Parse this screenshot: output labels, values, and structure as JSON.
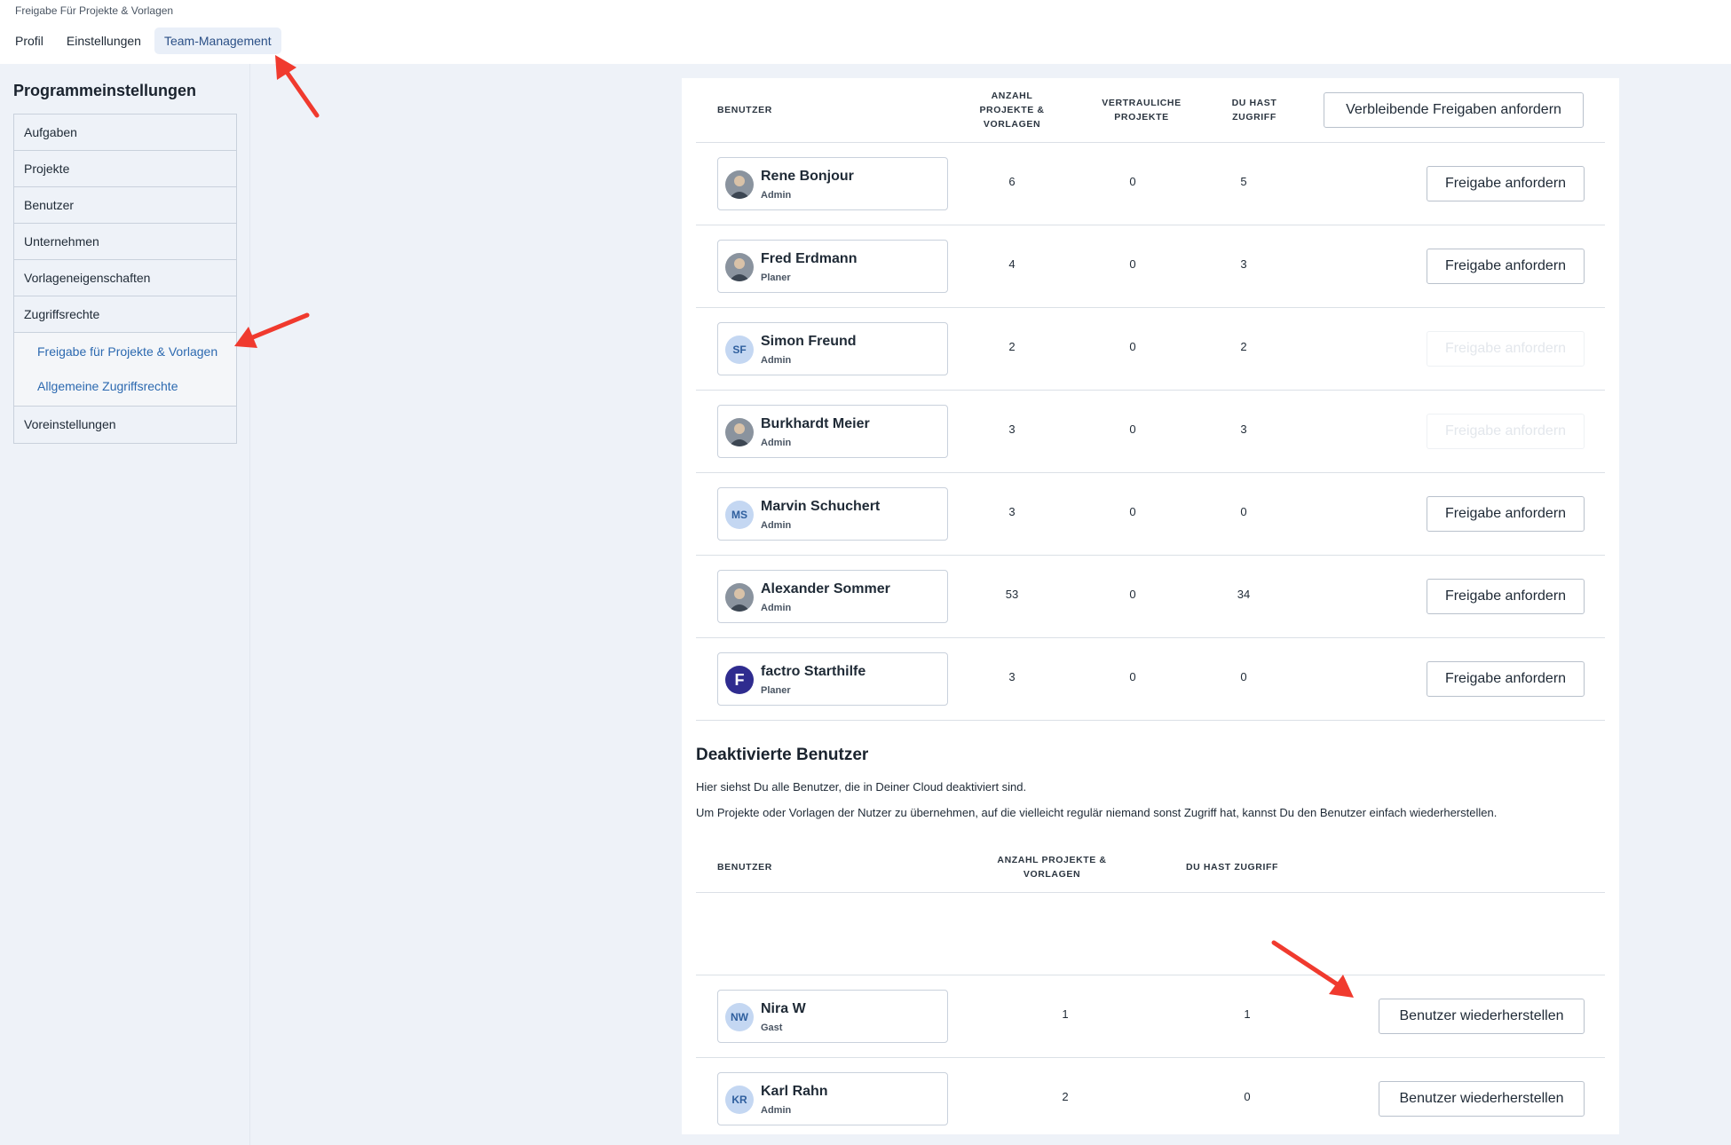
{
  "breadcrumb": "Freigabe Für Projekte & Vorlagen",
  "tabs": [
    {
      "label": "Profil"
    },
    {
      "label": "Einstellungen"
    },
    {
      "label": "Team-Management",
      "active": true
    }
  ],
  "sidebar": {
    "title": "Programmeinstellungen",
    "items": [
      {
        "label": "Aufgaben"
      },
      {
        "label": "Projekte"
      },
      {
        "label": "Benutzer"
      },
      {
        "label": "Unternehmen"
      },
      {
        "label": "Vorlageneigenschaften"
      },
      {
        "label": "Zugriffsrechte"
      },
      {
        "label": "Voreinstellungen"
      }
    ],
    "subitems": [
      {
        "label": "Freigabe für Projekte & Vorlagen"
      },
      {
        "label": "Allgemeine Zugriffsrechte"
      }
    ]
  },
  "active_table": {
    "headers": {
      "user": "BENUTZER",
      "count": "ANZAHL PROJEKTE & VORLAGEN",
      "confidential": "VERTRAULICHE PROJEKTE",
      "access": "DU HAST ZUGRIFF"
    },
    "request_all_label": "Verbleibende Freigaben anfordern",
    "rows": [
      {
        "name": "Rene Bonjour",
        "role": "Admin",
        "initials": "",
        "avatar": "photo",
        "count": "6",
        "confidential": "0",
        "access": "5",
        "button": "Freigabe anfordern",
        "enabled": true
      },
      {
        "name": "Fred Erdmann",
        "role": "Planer",
        "initials": "",
        "avatar": "photo",
        "count": "4",
        "confidential": "0",
        "access": "3",
        "button": "Freigabe anfordern",
        "enabled": true
      },
      {
        "name": "Simon Freund",
        "role": "Admin",
        "initials": "SF",
        "avatar": "initials",
        "count": "2",
        "confidential": "0",
        "access": "2",
        "button": "Freigabe anfordern",
        "enabled": false
      },
      {
        "name": "Burkhardt Meier",
        "role": "Admin",
        "initials": "",
        "avatar": "photo",
        "count": "3",
        "confidential": "0",
        "access": "3",
        "button": "Freigabe anfordern",
        "enabled": false
      },
      {
        "name": "Marvin Schuchert",
        "role": "Admin",
        "initials": "MS",
        "avatar": "initials",
        "count": "3",
        "confidential": "0",
        "access": "0",
        "button": "Freigabe anfordern",
        "enabled": true
      },
      {
        "name": "Alexander Sommer",
        "role": "Admin",
        "initials": "",
        "avatar": "photo",
        "count": "53",
        "confidential": "0",
        "access": "34",
        "button": "Freigabe anfordern",
        "enabled": true
      },
      {
        "name": "factro Starthilfe",
        "role": "Planer",
        "initials": "F",
        "avatar": "logo",
        "count": "3",
        "confidential": "0",
        "access": "0",
        "button": "Freigabe anfordern",
        "enabled": true
      }
    ]
  },
  "deactivated": {
    "title": "Deaktivierte Benutzer",
    "desc1": "Hier siehst Du alle Benutzer, die in Deiner Cloud deaktiviert sind.",
    "desc2": "Um Projekte oder Vorlagen der Nutzer zu übernehmen, auf die vielleicht regulär niemand sonst Zugriff hat, kannst Du den Benutzer einfach wiederherstellen.",
    "headers": {
      "user": "BENUTZER",
      "count": "ANZAHL PROJEKTE & VORLAGEN",
      "access": "DU HAST ZUGRIFF"
    },
    "rows": [
      {
        "name": "Nira W",
        "role": "Gast",
        "initials": "NW",
        "count": "1",
        "access": "1",
        "button": "Benutzer wiederherstellen"
      },
      {
        "name": "Karl Rahn",
        "role": "Admin",
        "initials": "KR",
        "count": "2",
        "access": "0",
        "button": "Benutzer wiederherstellen"
      }
    ]
  },
  "colors": {
    "accent": "#2c69b0",
    "annotation_arrow": "#f03a2e",
    "background": "#eef2f8"
  }
}
